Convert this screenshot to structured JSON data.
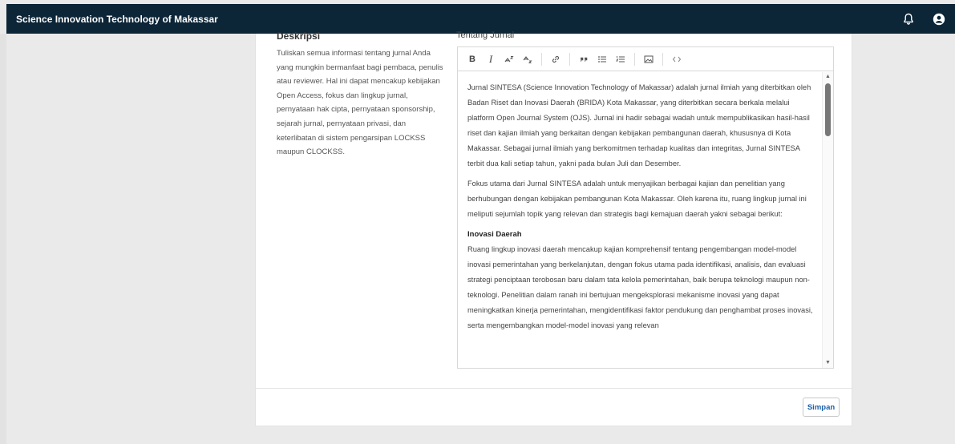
{
  "topbar": {
    "title": "Science Innovation Technology of Makassar",
    "icons": [
      "bell-icon",
      "user-circle-icon"
    ]
  },
  "description": {
    "heading": "Deskripsi",
    "text": "Tuliskan semua informasi tentang jurnal Anda yang mungkin bermanfaat bagi pembaca, penulis atau reviewer. Hal ini dapat mencakup kebijakan Open Access, fokus dan lingkup jurnal, pernyataan hak cipta, pernyataan sponsorship, sejarah jurnal, pernyataan privasi, dan keterlibatan di sistem pengarsipan LOCKSS maupun CLOCKSS."
  },
  "editor": {
    "label": "Tentang Jurnal",
    "toolbar": {
      "bold": "B",
      "italic": "I",
      "icons": [
        "bold-icon",
        "italic-icon",
        "superscript-icon",
        "subscript-icon",
        "link-icon",
        "blockquote-icon",
        "bulleted-list-icon",
        "numbered-list-icon",
        "image-icon",
        "code-icon"
      ]
    },
    "paragraphs": [
      "Jurnal SINTESA (Science Innovation Technology of Makassar) adalah jurnal ilmiah yang diterbitkan oleh Badan Riset dan Inovasi Daerah (BRIDA) Kota Makassar, yang diterbitkan secara berkala melalui platform Open Journal System (OJS). Jurnal ini hadir sebagai wadah untuk mempublikasikan hasil-hasil riset dan kajian ilmiah yang berkaitan dengan kebijakan pembangunan daerah, khususnya di Kota Makassar. Sebagai jurnal ilmiah yang berkomitmen terhadap kualitas dan integritas, Jurnal SINTESA terbit dua kali setiap tahun, yakni pada bulan Juli dan Desember.",
      "Fokus utama dari Jurnal SINTESA adalah untuk menyajikan berbagai kajian dan penelitian yang berhubungan dengan kebijakan pembangunan Kota Makassar. Oleh karena itu, ruang lingkup jurnal ini meliputi sejumlah topik yang relevan dan strategis bagi kemajuan daerah yakni sebagai berikut:"
    ],
    "section_heading": "Inovasi Daerah",
    "section_text": "Ruang lingkup inovasi daerah mencakup kajian komprehensif tentang pengembangan model-model inovasi pemerintahan yang berkelanjutan, dengan fokus utama pada identifikasi, analisis, dan evaluasi strategi penciptaan terobosan baru dalam tata kelola pemerintahan, baik berupa teknologi maupun non-teknologi. Penelitian dalam ranah ini bertujuan mengeksplorasi mekanisme inovasi yang dapat meningkatkan kinerja pemerintahan, mengidentifikasi faktor pendukung dan penghambat proses inovasi, serta mengembangkan model-model inovasi yang relevan"
  },
  "actions": {
    "save_label": "Simpan"
  },
  "colors": {
    "topbar": "#0c2537",
    "accent": "#1a5fa8"
  }
}
